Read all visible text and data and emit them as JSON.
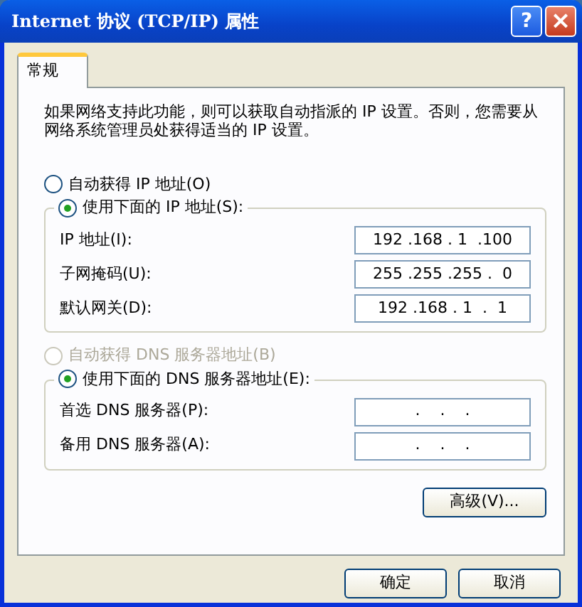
{
  "window": {
    "title": "Internet 协议 (TCP/IP) 属性",
    "help_button": "?",
    "close_button": "×"
  },
  "tabs": [
    {
      "label": "常规",
      "selected": true
    }
  ],
  "description": "如果网络支持此功能，则可以获取自动指派的 IP 设置。否则，您需要从网络系统管理员处获得适当的 IP 设置。",
  "ip_section": {
    "auto_option": {
      "label": "自动获得 IP 地址(O)",
      "selected": false,
      "disabled": false
    },
    "manual_option": {
      "label": "使用下面的 IP 地址(S):",
      "selected": true,
      "disabled": false
    },
    "fields": [
      {
        "label": "IP 地址(I):",
        "value": "192 .168 . 1  .100"
      },
      {
        "label": "子网掩码(U):",
        "value": "255 .255 .255 .  0"
      },
      {
        "label": "默认网关(D):",
        "value": "192 .168 . 1  .  1"
      }
    ]
  },
  "dns_section": {
    "auto_option": {
      "label": "自动获得 DNS 服务器地址(B)",
      "selected": false,
      "disabled": true
    },
    "manual_option": {
      "label": "使用下面的 DNS 服务器地址(E):",
      "selected": true,
      "disabled": false
    },
    "fields": [
      {
        "label": "首选 DNS 服务器(P):",
        "value": ".    .    ."
      },
      {
        "label": "备用 DNS 服务器(A):",
        "value": ".    .    ."
      }
    ]
  },
  "advanced_button": "高级(V)...",
  "buttons": [
    "确定",
    "取消"
  ]
}
